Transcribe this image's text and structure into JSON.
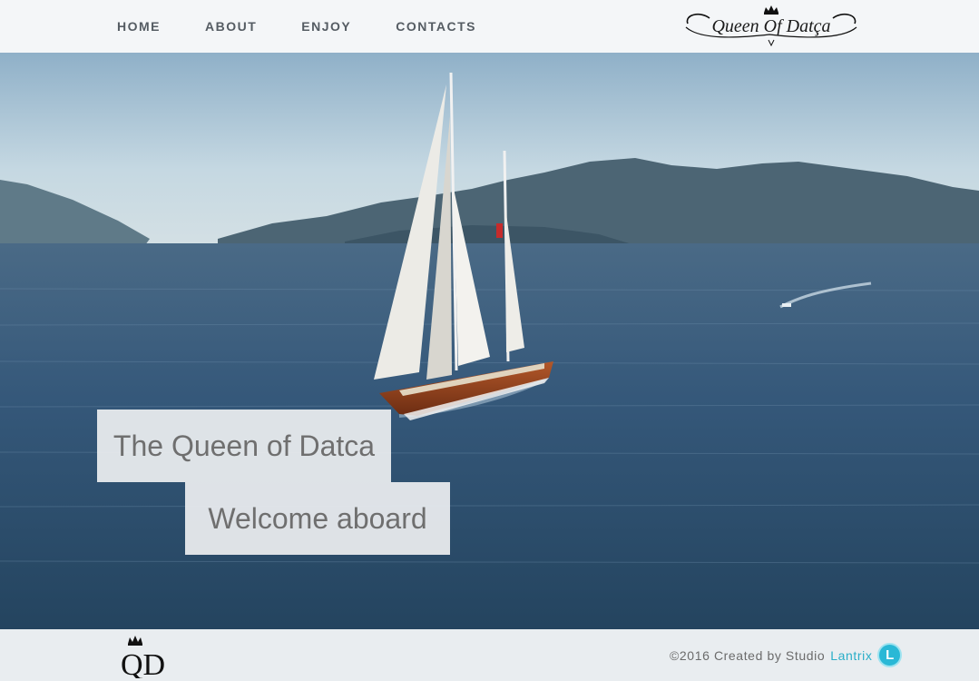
{
  "nav": {
    "items": [
      {
        "label": "HOME"
      },
      {
        "label": "ABOUT"
      },
      {
        "label": "ENJOY"
      },
      {
        "label": "CONTACTS"
      }
    ]
  },
  "logo": {
    "text": "Queen Of Datça"
  },
  "hero": {
    "title": "The Queen of Datca",
    "subtitle": "Welcome aboard"
  },
  "footer": {
    "monogram": "QD",
    "credit_prefix": "©2016 Created by Studio",
    "studio_name": "Lantrix",
    "studio_icon_letter": "L"
  },
  "colors": {
    "header_bg": "#f4f6f8",
    "nav_text": "#555c63",
    "caption_bg": "#eceef0",
    "caption_text": "#6f6f6f",
    "footer_bg": "#e9edf0",
    "accent": "#2aaec8"
  }
}
